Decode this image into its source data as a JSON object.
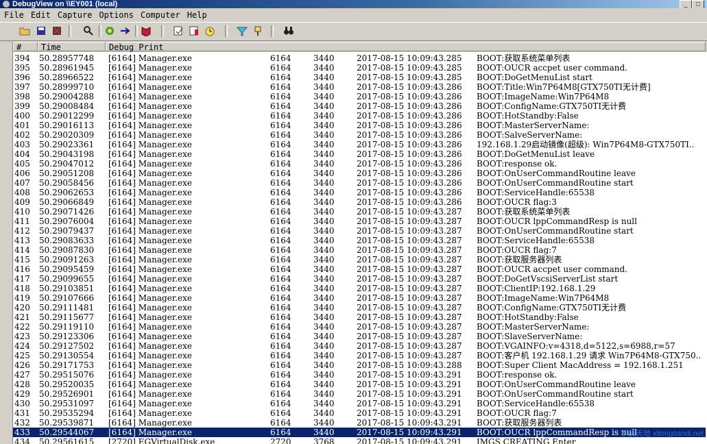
{
  "window": {
    "title": "DebugView on \\\\EY001 (local)"
  },
  "menu": [
    "File",
    "Edit",
    "Capture",
    "Options",
    "Computer",
    "Help"
  ],
  "toolbar": [
    {
      "name": "open-icon",
      "color": "#c8a040"
    },
    {
      "name": "save-icon",
      "color": "#202080"
    },
    {
      "name": "clear-icon",
      "color": "#c02020"
    },
    {
      "name": "find-icon",
      "color": "#202020"
    },
    {
      "name": "capture-icon",
      "color": "#208020"
    },
    {
      "name": "autoscroll-icon",
      "color": "#101080"
    },
    {
      "name": "capture-kernel-icon",
      "color": "#c02040"
    },
    {
      "name": "edit-filter-icon",
      "color": "#404040"
    },
    {
      "name": "highlight-icon",
      "color": "#c02020"
    },
    {
      "name": "timer-icon",
      "color": "#c0a020"
    },
    {
      "name": "filter-icon",
      "color": "#20a0c0"
    },
    {
      "name": "pin-icon",
      "color": "#806020"
    },
    {
      "name": "binoculars-icon",
      "color": "#202020"
    }
  ],
  "columns": [
    "#",
    "Time",
    "Debug Print"
  ],
  "rows": [
    [
      "394",
      "50.28957748",
      "[6164] Manager.exe",
      "6164",
      "3440",
      "2017-08-15 10:09:43.285",
      "BOOT:获取系统菜单列表"
    ],
    [
      "395",
      "50.28961945",
      "[6164] Manager.exe",
      "6164",
      "3440",
      "2017-08-15 10:09:43.285",
      "BOOT:OUCR accpet user command."
    ],
    [
      "396",
      "50.28966522",
      "[6164] Manager.exe",
      "6164",
      "3440",
      "2017-08-15 10:09:43.285",
      "BOOT:DoGetMenuList start"
    ],
    [
      "397",
      "50.28999710",
      "[6164] Manager.exe",
      "6164",
      "3440",
      "2017-08-15 10:09:43.286",
      "BOOT:Title:Win7P64M8[GTX750TI无计费]"
    ],
    [
      "398",
      "50.29004288",
      "[6164] Manager.exe",
      "6164",
      "3440",
      "2017-08-15 10:09:43.286",
      "BOOT:ImageName:Win7P64M8"
    ],
    [
      "399",
      "50.29008484",
      "[6164] Manager.exe",
      "6164",
      "3440",
      "2017-08-15 10:09:43.286",
      "BOOT:ConfigName:GTX750TI无计费"
    ],
    [
      "400",
      "50.29012299",
      "[6164] Manager.exe",
      "6164",
      "3440",
      "2017-08-15 10:09:43.286",
      "BOOT:HotStandby:False"
    ],
    [
      "401",
      "50.29016113",
      "[6164] Manager.exe",
      "6164",
      "3440",
      "2017-08-15 10:09:43.286",
      "BOOT:MasterServerName:"
    ],
    [
      "402",
      "50.29020309",
      "[6164] Manager.exe",
      "6164",
      "3440",
      "2017-08-15 10:09:43.286",
      "BOOT:SalveServerName:"
    ],
    [
      "403",
      "50.29023361",
      "[6164] Manager.exe",
      "6164",
      "3440",
      "2017-08-15 10:09:43.286",
      "192.168.1.29启动镜像(超级): Win7P64M8-GTX750TI.."
    ],
    [
      "404",
      "50.29043198",
      "[6164] Manager.exe",
      "6164",
      "3440",
      "2017-08-15 10:09:43.286",
      "BOOT:DoGetMenuList leave"
    ],
    [
      "405",
      "50.29047012",
      "[6164] Manager.exe",
      "6164",
      "3440",
      "2017-08-15 10:09:43.286",
      "BOOT:response ok."
    ],
    [
      "406",
      "50.29051208",
      "[6164] Manager.exe",
      "6164",
      "3440",
      "2017-08-15 10:09:43.286",
      "BOOT:OnUserCommandRoutine leave"
    ],
    [
      "407",
      "50.29058456",
      "[6164] Manager.exe",
      "6164",
      "3440",
      "2017-08-15 10:09:43.286",
      "BOOT:OnUserCommandRoutine start"
    ],
    [
      "408",
      "50.29062653",
      "[6164] Manager.exe",
      "6164",
      "3440",
      "2017-08-15 10:09:43.286",
      "BOOT:ServiceHandle:65538"
    ],
    [
      "409",
      "50.29066849",
      "[6164] Manager.exe",
      "6164",
      "3440",
      "2017-08-15 10:09:43.286",
      "BOOT:OUCR flag:3"
    ],
    [
      "410",
      "50.29071426",
      "[6164] Manager.exe",
      "6164",
      "3440",
      "2017-08-15 10:09:43.287",
      "BOOT:获取系统菜单列表"
    ],
    [
      "411",
      "50.29076004",
      "[6164] Manager.exe",
      "6164",
      "3440",
      "2017-08-15 10:09:43.287",
      "BOOT:OUCR lppCommandResp is null"
    ],
    [
      "412",
      "50.29079437",
      "[6164] Manager.exe",
      "6164",
      "3440",
      "2017-08-15 10:09:43.287",
      "BOOT:OnUserCommandRoutine start"
    ],
    [
      "413",
      "50.29083633",
      "[6164] Manager.exe",
      "6164",
      "3440",
      "2017-08-15 10:09:43.287",
      "BOOT:ServiceHandle:65538"
    ],
    [
      "414",
      "50.29087830",
      "[6164] Manager.exe",
      "6164",
      "3440",
      "2017-08-15 10:09:43.287",
      "BOOT:OUCR flag:7"
    ],
    [
      "415",
      "50.29091263",
      "[6164] Manager.exe",
      "6164",
      "3440",
      "2017-08-15 10:09:43.287",
      "BOOT:获取服务器列表"
    ],
    [
      "416",
      "50.29095459",
      "[6164] Manager.exe",
      "6164",
      "3440",
      "2017-08-15 10:09:43.287",
      "BOOT:OUCR accpet user command."
    ],
    [
      "417",
      "50.29099655",
      "[6164] Manager.exe",
      "6164",
      "3440",
      "2017-08-15 10:09:43.287",
      "BOOT:DoGetVscsiServerList start"
    ],
    [
      "418",
      "50.29103851",
      "[6164] Manager.exe",
      "6164",
      "3440",
      "2017-08-15 10:09:43.287",
      "BOOT:ClientIP:192.168.1.29"
    ],
    [
      "419",
      "50.29107666",
      "[6164] Manager.exe",
      "6164",
      "3440",
      "2017-08-15 10:09:43.287",
      "BOOT:ImageName:Win7P64M8"
    ],
    [
      "420",
      "50.29111481",
      "[6164] Manager.exe",
      "6164",
      "3440",
      "2017-08-15 10:09:43.287",
      "BOOT:ConfigName:GTX750TI无计费"
    ],
    [
      "421",
      "50.29115677",
      "[6164] Manager.exe",
      "6164",
      "3440",
      "2017-08-15 10:09:43.287",
      "BOOT:HotStandby:False"
    ],
    [
      "422",
      "50.29119110",
      "[6164] Manager.exe",
      "6164",
      "3440",
      "2017-08-15 10:09:43.287",
      "BOOT:MasterServerName:"
    ],
    [
      "423",
      "50.29123306",
      "[6164] Manager.exe",
      "6164",
      "3440",
      "2017-08-15 10:09:43.287",
      "BOOT:SlaveServerName:"
    ],
    [
      "424",
      "50.29127502",
      "[6164] Manager.exe",
      "6164",
      "3440",
      "2017-08-15 10:09:43.287",
      "BOOT:VGAINFO:v=4318,d=5122,s=6988,r=57"
    ],
    [
      "425",
      "50.29130554",
      "[6164] Manager.exe",
      "6164",
      "3440",
      "2017-08-15 10:09:43.287",
      "BOOT:客户机 192.168.1.29 请求 Win7P64M8-GTX750.."
    ],
    [
      "426",
      "50.29171753",
      "[6164] Manager.exe",
      "6164",
      "3440",
      "2017-08-15 10:09:43.288",
      "BOOT:Super Client MacAddress = 192.168.1.251"
    ],
    [
      "427",
      "50.29515076",
      "[6164] Manager.exe",
      "6164",
      "3440",
      "2017-08-15 10:09:43.291",
      "BOOT:response ok."
    ],
    [
      "428",
      "50.29520035",
      "[6164] Manager.exe",
      "6164",
      "3440",
      "2017-08-15 10:09:43.291",
      "BOOT:OnUserCommandRoutine leave"
    ],
    [
      "429",
      "50.29526901",
      "[6164] Manager.exe",
      "6164",
      "3440",
      "2017-08-15 10:09:43.291",
      "BOOT:OnUserCommandRoutine start"
    ],
    [
      "430",
      "50.29531097",
      "[6164] Manager.exe",
      "6164",
      "3440",
      "2017-08-15 10:09:43.291",
      "BOOT:ServiceHandle:65538"
    ],
    [
      "431",
      "50.29535294",
      "[6164] Manager.exe",
      "6164",
      "3440",
      "2017-08-15 10:09:43.291",
      "BOOT:OUCR flag:7"
    ],
    [
      "432",
      "50.29539871",
      "[6164] Manager.exe",
      "6164",
      "3440",
      "2017-08-15 10:09:43.291",
      "BOOT:获取服务器列表"
    ],
    [
      "433",
      "50.29544067",
      "[6164] Manager.exe",
      "6164",
      "3440",
      "2017-08-15 10:09:43.291",
      "BOOT:OUCR lppCommandResp is null"
    ],
    [
      "434",
      "50.29561615",
      "[2720] EGVirtualDisk.exe",
      "2720",
      "3768",
      "2017-08-15 10:09:43.291",
      "IMGS CREATING Enter"
    ]
  ],
  "selected_row": "433",
  "watermark": "系统天地 xitongtiandi.net"
}
